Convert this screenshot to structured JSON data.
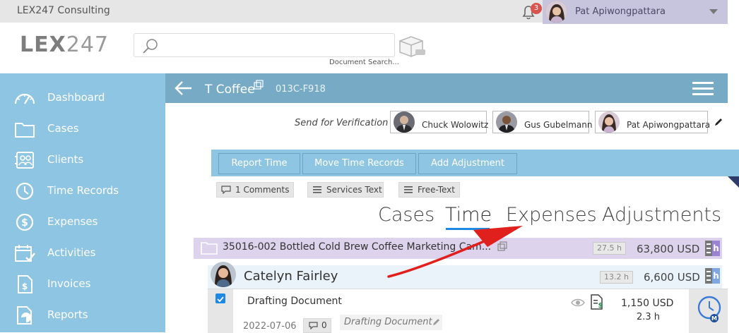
{
  "topbar": {
    "company": "LEX247 Consulting",
    "notifications": "3",
    "user_name": "Pat Apiwongpattara"
  },
  "logo": {
    "bold": "LEX",
    "light": "247"
  },
  "search": {
    "value": "",
    "placeholder": "",
    "hint": "Document Search..."
  },
  "sidebar": {
    "items": [
      {
        "label": "Dashboard",
        "icon": "dashboard-gauge-icon"
      },
      {
        "label": "Cases",
        "icon": "folder-icon"
      },
      {
        "label": "Clients",
        "icon": "contacts-icon"
      },
      {
        "label": "Time Records",
        "icon": "clock-icon"
      },
      {
        "label": "Expenses",
        "icon": "dollar-circle-icon"
      },
      {
        "label": "Activities",
        "icon": "calendar-check-icon"
      },
      {
        "label": "Invoices",
        "icon": "invoice-icon"
      },
      {
        "label": "Reports",
        "icon": "report-chart-icon"
      }
    ]
  },
  "case": {
    "name": "T Coffee",
    "code": "013C-F918"
  },
  "verification": {
    "label": "Send for Verification",
    "people": [
      "Chuck Wolowitz",
      "Gus Gubelmann",
      "Pat Apiwongpattara"
    ]
  },
  "actions": [
    "Report Time",
    "Move Time Records",
    "Add Adjustment"
  ],
  "chips": [
    {
      "label": "1 Comments",
      "icon": "comment-icon"
    },
    {
      "label": "Services Text",
      "icon": "list-icon"
    },
    {
      "label": "Free-Text",
      "icon": "list-icon"
    }
  ],
  "tabs": [
    {
      "label": "Cases",
      "active": false
    },
    {
      "label": "Time",
      "active": true
    },
    {
      "label": "Expenses",
      "active": false
    },
    {
      "label": "Adjustments",
      "active": false
    }
  ],
  "matter": {
    "title": "35016-002 Bottled Cold Brew Coffee Marketing Cam...",
    "hours": "27.5 h",
    "amount": "63,800 USD",
    "hbox_label": "h"
  },
  "person": {
    "name": "Catelyn Fairley",
    "hours": "13.2 h",
    "amount": "6,600 USD",
    "hbox_label": "h"
  },
  "entry": {
    "title": "Drafting Document",
    "date": "2022-07-06",
    "comments": "0",
    "description": "Drafting Document",
    "amount": "1,150 USD",
    "hours": "2.3 h",
    "timer_badge": "M"
  },
  "colors": {
    "sidebar": "#8ec5e2",
    "header": "#77aac5",
    "matter_row": "#ddd3ec",
    "hbox_accent": "#9b83d4",
    "hbox_accent_person": "#7ea6e0",
    "annotation_arrow": "#e0201c"
  }
}
